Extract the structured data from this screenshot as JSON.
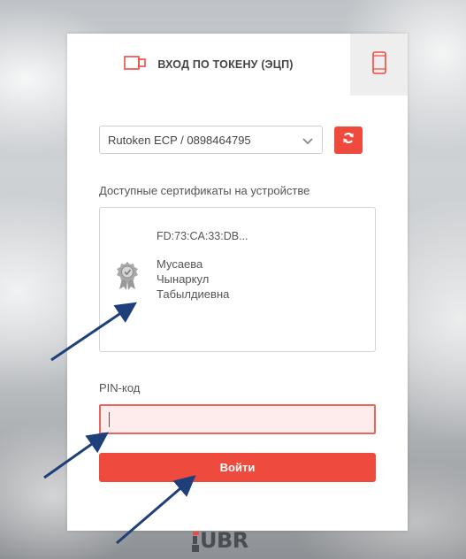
{
  "tabs": {
    "token_label": "ВХОД ПО ТОКЕНУ (ЭЦП)",
    "token_icon": "token-device-icon",
    "mobile_icon": "mobile-phone-icon"
  },
  "device_select": {
    "value": "Rutoken ECP / 0898464795",
    "icon": "chevron-down-icon"
  },
  "refresh_button": {
    "icon": "refresh-icon"
  },
  "certificates": {
    "label": "Доступные сертификаты на устройстве",
    "items": [
      {
        "id": "FD:73:CA:33:DB...",
        "name_lines": [
          "Мусаева",
          "Чынаркул",
          "Табылдиевна"
        ],
        "icon": "certificate-badge-icon"
      }
    ]
  },
  "pin": {
    "label": "PIN-код",
    "value": ""
  },
  "login_button": {
    "label": "Войти"
  },
  "logo": {
    "text": "UBR"
  },
  "colors": {
    "accent": "#ef4a3e",
    "input_error_bg": "#fdeceb",
    "arrow": "#1f3f7a"
  }
}
